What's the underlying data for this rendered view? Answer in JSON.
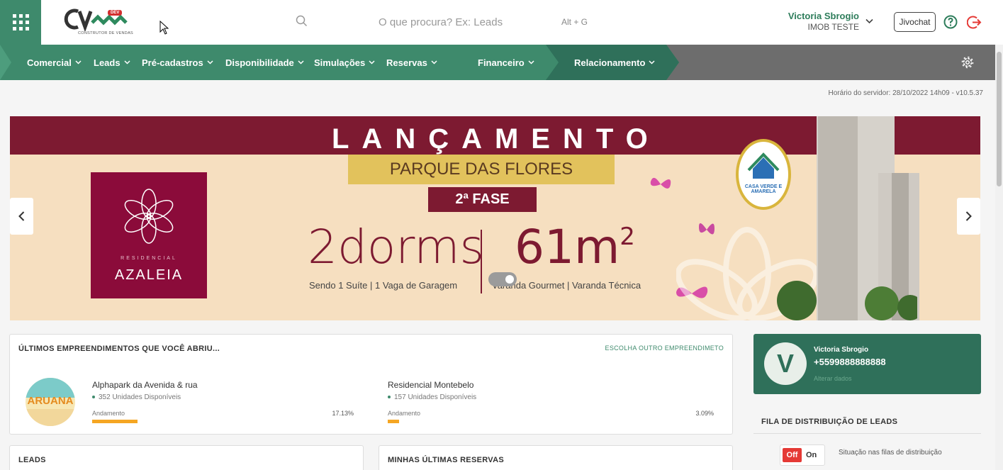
{
  "header": {
    "logo_text": "CV",
    "logo_badge": "DEV",
    "logo_subtitle": "CONSTRUTOR DE VENDAS",
    "search_placeholder": "O que procura? Ex: Leads",
    "search_shortcut": "Alt + G",
    "user_name": "Victoria Sbrogio",
    "user_org": "IMOB TESTE",
    "jivochat_label": "Jivochat"
  },
  "nav": {
    "items": [
      {
        "label": "Comercial"
      },
      {
        "label": "Leads"
      },
      {
        "label": "Pré-cadastros"
      },
      {
        "label": "Disponibilidade"
      },
      {
        "label": "Simulações"
      },
      {
        "label": "Reservas"
      },
      {
        "label": "Financeiro"
      },
      {
        "label": "Relacionamento"
      }
    ],
    "colors": {
      "green": "#3e8a6c",
      "gray": "#6d6d6d"
    }
  },
  "server_time": "Horário do servidor: 28/10/2022 14h09 - v10.5.37",
  "banner": {
    "title": "LANÇAMENTO",
    "ribbon": "PARQUE DAS FLORES",
    "phase": "2ª FASE",
    "brand_small": "RESIDENCIAL",
    "brand_name": "AZALEIA",
    "dorms": "2dorms",
    "dorms_sub": "Sendo 1 Suíte  |  1 Vaga de Garagem",
    "area": "61m",
    "area_sup": "2",
    "area_sub": "Varanda Gourmet  |  Varanda Técnica",
    "seal_text": "CASA VERDE E AMARELA"
  },
  "empreendimentos": {
    "title": "ÚLTIMOS EMPREENDIMENTOS QUE VOCÊ ABRIU...",
    "link": "ESCOLHA OUTRO EMPREENDIMETO",
    "items": [
      {
        "name": "Alphapark da Avenida & rua",
        "units": "352 Unidades Disponíveis",
        "label": "Andamento",
        "pct": "17.13%",
        "progress": 17.13,
        "logo_text": "ARUANA"
      },
      {
        "name": "Residencial Montebelo",
        "units": "157 Unidades Disponíveis",
        "label": "Andamento",
        "pct": "3.09%",
        "progress": 3.09
      }
    ]
  },
  "user_card": {
    "initial": "V",
    "name": "Victoria Sbrogio",
    "phone": "+5599888888888",
    "edit_link": "Alterar dados"
  },
  "fila": {
    "title": "FILA DE DISTRIBUIÇÃO DE LEADS",
    "off": "Off",
    "on": "On",
    "status": "Situação nas filas de distribuição"
  },
  "leads_card": {
    "title": "LEADS"
  },
  "reservas_card": {
    "title": "MINHAS ÚLTIMAS RESERVAS"
  }
}
